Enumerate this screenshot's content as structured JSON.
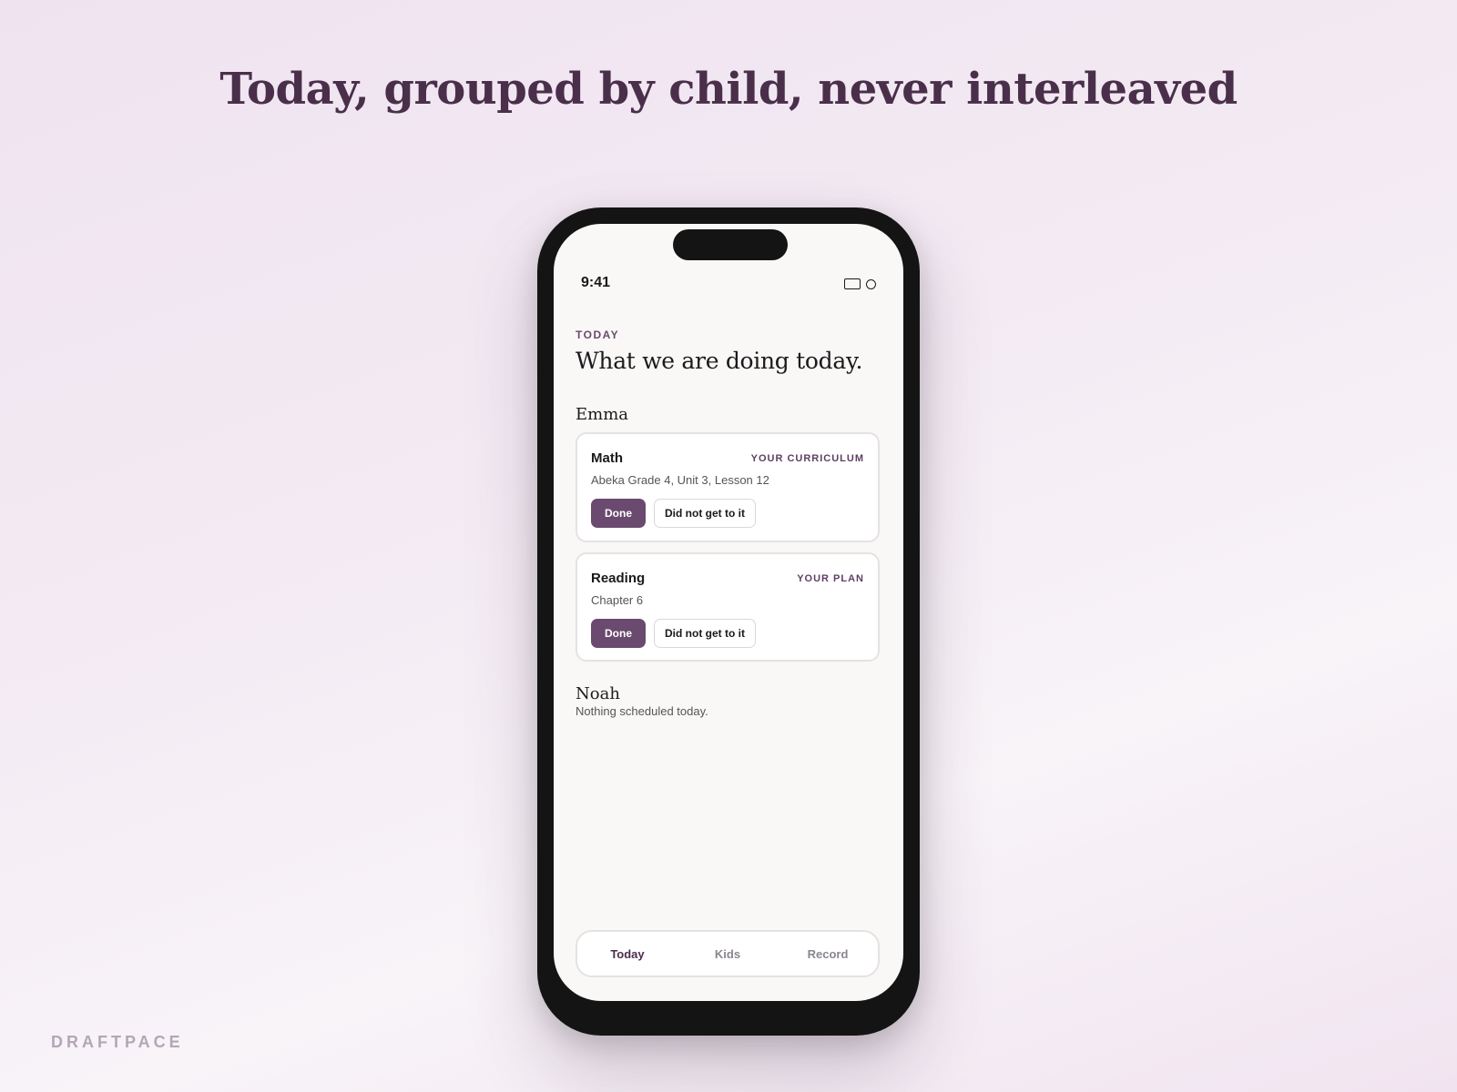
{
  "headline": "Today, grouped by child, never interleaved",
  "brand": "DRAFTPACE",
  "status_bar": {
    "time": "9:41",
    "icons": [
      "battery-icon",
      "circle-icon"
    ]
  },
  "screen": {
    "eyebrow": "TODAY",
    "title": "What we are doing today.",
    "children": [
      {
        "name": "Emma",
        "items": [
          {
            "subject": "Math",
            "tag": "YOUR CURRICULUM",
            "detail": "Abeka Grade 4, Unit 3, Lesson 12",
            "done_label": "Done",
            "skip_label": "Did not get to it"
          },
          {
            "subject": "Reading",
            "tag": "YOUR PLAN",
            "detail": "Chapter 6",
            "done_label": "Done",
            "skip_label": "Did not get to it"
          }
        ]
      },
      {
        "name": "Noah",
        "empty_text": "Nothing scheduled today."
      }
    ]
  },
  "tabbar": {
    "tabs": [
      "Today",
      "Kids",
      "Record"
    ],
    "active": "Today"
  },
  "colors": {
    "accent": "#6a4a6e",
    "headline": "#4a2f4b",
    "screen_bg": "#faf8f6"
  }
}
